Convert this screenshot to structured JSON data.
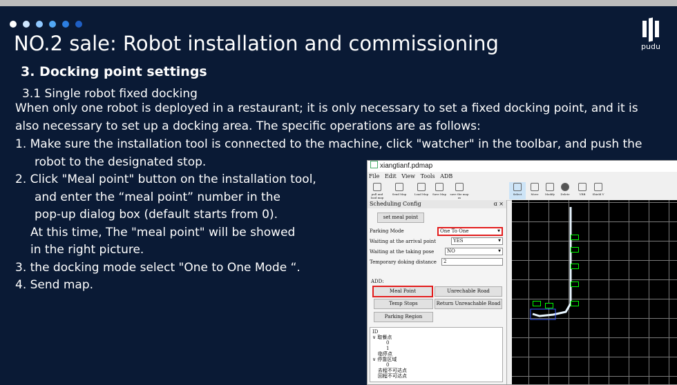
{
  "slide": {
    "title": "NO.2 sale: Robot installation and commissioning",
    "brand": "pudu",
    "section_heading": "3. Docking point settings",
    "subheading": "3.1  Single robot fixed docking",
    "intro_line1": "When only one robot is deployed in a restaurant; it is only necessary to set a fixed docking point, and it is",
    "intro_line2": "also necessary to set up a docking area. The specific operations are as follows:",
    "step1_line1": "1.  Make sure the installation tool is connected to the machine, click \"watcher\" in the toolbar, and push the",
    "step1_line2": "robot to the designated stop.",
    "step2_line1": "2.  Click  \"Meal point\" button on the installation tool,",
    "step2_line2": "and enter the  “meal point”  number in the",
    "step2_line3": "pop-up dialog box (default starts from 0).",
    "step2_line4": "At this time, The \"meal point\" will be showed",
    "step2_line5": "in the right picture.",
    "step3": "3. the docking mode select \"One to One Mode  “.",
    "step4": "4. Send map.",
    "dot_colors": [
      "#ffffff",
      "#cfe6ff",
      "#8fc8ff",
      "#52a8f5",
      "#2c7ee0",
      "#1f5fc4"
    ]
  },
  "app": {
    "window_title": "xiangtianf.pdmap",
    "menu": [
      "File",
      "Edit",
      "View",
      "Tools",
      "ADB"
    ],
    "toolbar": [
      "pull and load map",
      "Send Map",
      "Load Map",
      "Save Map",
      "save the map as",
      "Select",
      "Move",
      "Modify",
      "Delete",
      "VRB",
      "Shield V"
    ],
    "panel_title": "Scheduling Config",
    "panel_close": "ɑ ×",
    "set_meal_point_label": "set meal point",
    "parking_mode_label": "Parking Mode",
    "parking_mode_value": "One To One",
    "waiting_arrival_label": "Waiting at the arrival point",
    "waiting_arrival_value": "YES",
    "waiting_taking_label": "Waiting at the taking pose",
    "waiting_taking_value": "NO",
    "temp_docking_label": "Temporary doking distance",
    "temp_docking_value": "2",
    "add_label": "ADD:",
    "meal_point_button": "Meal Point",
    "unreachable_road_button": "Unrechable Road",
    "temp_stops_button": "Temp Stops",
    "return_unreachable_button": "Return Unreachable Road",
    "parking_region_button": "Parking Region",
    "tree": {
      "header": "ID",
      "group1": "取餐点",
      "item0": "0",
      "item1": "1",
      "stop_point": "临停点",
      "group2": "停靠区域",
      "item2": "0",
      "unreachable_go": "去程不可达点",
      "unreachable_return": "回程不可达点"
    }
  }
}
